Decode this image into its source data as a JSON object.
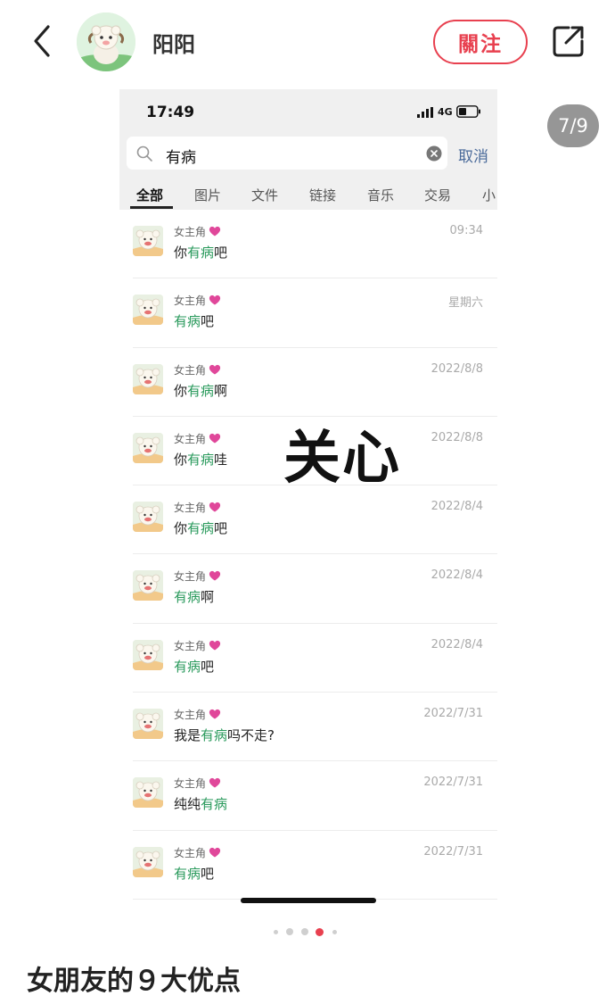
{
  "header": {
    "username": "阳阳",
    "follow_label": "關注"
  },
  "image_viewer": {
    "page_indicator": "7/9",
    "current_page": 7,
    "total_pages": 9,
    "caption": "关心"
  },
  "screenshot": {
    "status_bar": {
      "time": "17:49",
      "network": "4G"
    },
    "search": {
      "query": "有病",
      "cancel_label": "取消"
    },
    "tabs": [
      "全部",
      "图片",
      "文件",
      "链接",
      "音乐",
      "交易",
      "小"
    ],
    "active_tab": "全部",
    "results": [
      {
        "sender": "女主角",
        "time": "09:34",
        "before": "你",
        "highlight": "有病",
        "after": "吧"
      },
      {
        "sender": "女主角",
        "time": "星期六",
        "before": "",
        "highlight": "有病",
        "after": "吧"
      },
      {
        "sender": "女主角",
        "time": "2022/8/8",
        "before": "你",
        "highlight": "有病",
        "after": "啊"
      },
      {
        "sender": "女主角",
        "time": "2022/8/8",
        "before": "你",
        "highlight": "有病",
        "after": "哇"
      },
      {
        "sender": "女主角",
        "time": "2022/8/4",
        "before": "你",
        "highlight": "有病",
        "after": "吧"
      },
      {
        "sender": "女主角",
        "time": "2022/8/4",
        "before": "",
        "highlight": "有病",
        "after": "啊"
      },
      {
        "sender": "女主角",
        "time": "2022/8/4",
        "before": "",
        "highlight": "有病",
        "after": "吧"
      },
      {
        "sender": "女主角",
        "time": "2022/7/31",
        "before": "我是",
        "highlight": "有病",
        "after": "吗不走?"
      },
      {
        "sender": "女主角",
        "time": "2022/7/31",
        "before": "纯纯",
        "highlight": "有病",
        "after": ""
      },
      {
        "sender": "女主角",
        "time": "2022/7/31",
        "before": "",
        "highlight": "有病",
        "after": "吧"
      }
    ]
  },
  "carousel": {
    "dot_count": 5,
    "active_index": 3
  },
  "post": {
    "title": "女朋友的９大优点"
  },
  "colors": {
    "accent_red": "#e8404f",
    "highlight_green": "#2a9a5c",
    "link_blue": "#4a6a9a",
    "heart_pink": "#e0479a"
  }
}
